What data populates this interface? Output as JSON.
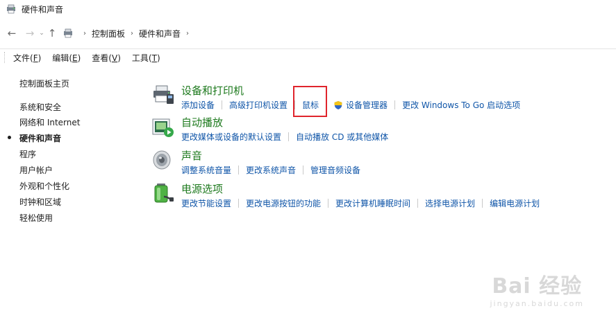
{
  "window": {
    "title": "硬件和声音"
  },
  "address": {
    "crumbs": [
      "控制面板",
      "硬件和声音"
    ],
    "sep": "›",
    "expand": "›"
  },
  "nav": {
    "back": "←",
    "forward": "→",
    "recent": "⌄",
    "up": "↑"
  },
  "menu": {
    "items": [
      {
        "label": "文件",
        "key": "F"
      },
      {
        "label": "编辑",
        "key": "E"
      },
      {
        "label": "查看",
        "key": "V"
      },
      {
        "label": "工具",
        "key": "T"
      }
    ]
  },
  "sidebar": {
    "items": [
      {
        "label": "控制面板主页"
      },
      {
        "label": "系统和安全"
      },
      {
        "label": "网络和 Internet"
      },
      {
        "label": "硬件和声音"
      },
      {
        "label": "程序"
      },
      {
        "label": "用户帐户"
      },
      {
        "label": "外观和个性化"
      },
      {
        "label": "时钟和区域"
      },
      {
        "label": "轻松使用"
      }
    ],
    "current_index": 3
  },
  "categories": [
    {
      "title": "设备和打印机",
      "icon": "printer-icon",
      "links": [
        "添加设备",
        "高级打印机设置",
        "鼠标",
        "设备管理器",
        "更改 Windows To Go 启动选项"
      ]
    },
    {
      "title": "自动播放",
      "icon": "autoplay-icon",
      "links": [
        "更改媒体或设备的默认设置",
        "自动播放 CD 或其他媒体"
      ]
    },
    {
      "title": "声音",
      "icon": "speaker-icon",
      "links": [
        "调整系统音量",
        "更改系统声音",
        "管理音频设备"
      ]
    },
    {
      "title": "电源选项",
      "icon": "battery-icon",
      "links": [
        "更改节能设置",
        "更改电源按钮的功能",
        "更改计算机睡眠时间",
        "选择电源计划",
        "编辑电源计划"
      ]
    }
  ],
  "colors": {
    "accent_green": "#1e7a1e",
    "link_blue": "#0f55a8",
    "highlight_red": "#e0242c"
  },
  "watermark": {
    "main": "Bai 经验",
    "sub": "jingyan.baidu.com"
  }
}
